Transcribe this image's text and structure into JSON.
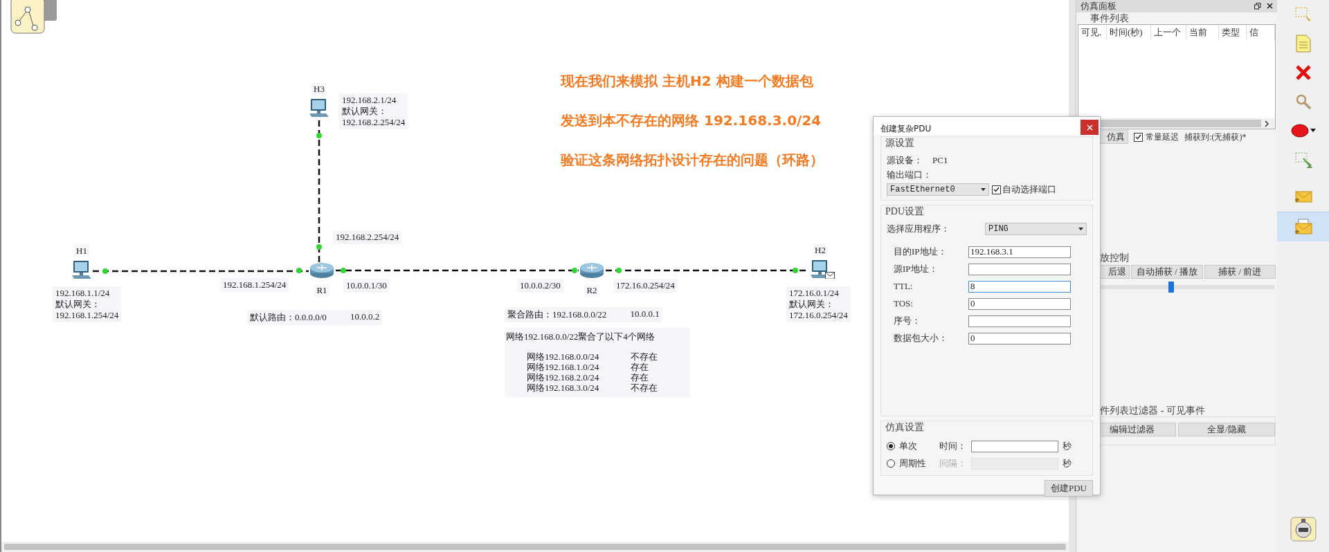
{
  "canvas": {
    "captions": [
      "现在我们来模拟 主机H2 构建一个数据包",
      "发送到本不存在的网络 192.168.3.0/24",
      "验证这条网络拓扑设计存在的问题（环路）"
    ],
    "devices": [
      {
        "kind": "pc",
        "name": "H1",
        "has_pdu": false
      },
      {
        "kind": "router",
        "name": "R1",
        "has_pdu": false
      },
      {
        "kind": "pc",
        "name": "H3",
        "has_pdu": false
      },
      {
        "kind": "router",
        "name": "R2",
        "has_pdu": false
      },
      {
        "kind": "pc",
        "name": "H2",
        "has_pdu": true
      }
    ],
    "notes": [
      {
        "kind": "stack",
        "lines": [
          "192.168.1.1/24",
          "默认网关：",
          "192.168.1.254/24"
        ]
      },
      {
        "kind": "stack",
        "lines": [
          "192.168.2.1/24",
          "默认网关：",
          "192.168.2.254/24"
        ]
      },
      {
        "kind": "stack",
        "lines": [
          "172.16.0.1/24",
          "默认网关：",
          "172.16.0.254/24"
        ]
      },
      {
        "kind": "stack",
        "lines": [
          "192.168.2.254/24"
        ]
      },
      {
        "kind": "stack",
        "lines": [
          "192.168.1.254/24"
        ]
      },
      {
        "kind": "stack",
        "lines": [
          "10.0.0.1/30"
        ]
      },
      {
        "kind": "row",
        "lines": [
          "默认路由：0.0.0.0/0",
          "10.0.0.2"
        ]
      },
      {
        "kind": "stack",
        "lines": [
          "10.0.0.2/30"
        ]
      },
      {
        "kind": "stack",
        "lines": [
          "172.16.0.254/24"
        ]
      },
      {
        "kind": "row",
        "lines": [
          "聚合路由：192.168.0.0/22",
          "10.0.0.1"
        ]
      }
    ],
    "summary": {
      "heading": "网络192.168.0.0/22聚合了以下4个网络",
      "rows": [
        {
          "network": "网络192.168.0.0/24",
          "status": "不存在"
        },
        {
          "network": "网络192.168.1.0/24",
          "status": "存在"
        },
        {
          "network": "网络192.168.2.0/24",
          "status": "存在"
        },
        {
          "network": "网络192.168.3.0/24",
          "status": "不存在"
        }
      ]
    }
  },
  "simulation_panel": {
    "title": "仿真面板",
    "event_list": {
      "title": "事件列表",
      "columns": [
        "可见.",
        "时间(秒)",
        "上一个",
        "当前",
        "类型",
        "信"
      ]
    },
    "options": {
      "button": "仿真",
      "constant_delay": {
        "label": "常量延迟",
        "checked": true
      },
      "captured": "捕获到:(无捕获)*"
    },
    "playback": {
      "title": "放控制",
      "buttons": [
        "后退",
        "自动捕获 / 播放",
        "捕获 / 前进"
      ],
      "speed": {
        "level": 0.47
      }
    },
    "filter": {
      "title": "件列表过滤器 - 可见事件",
      "buttons": [
        "编辑过滤器",
        "全显/隐藏"
      ]
    }
  },
  "toolbar": [
    {
      "kind": "select",
      "selected": false
    },
    {
      "kind": "note",
      "selected": false
    },
    {
      "kind": "delete",
      "selected": false
    },
    {
      "kind": "inspect",
      "selected": false
    },
    {
      "kind": "ellipse",
      "selected": false
    },
    {
      "kind": "resize",
      "selected": false
    },
    {
      "kind": "simple_pdu",
      "selected": false
    },
    {
      "kind": "complex_pdu",
      "selected": true
    }
  ],
  "dialog": {
    "title": "创建复杂PDU",
    "source": {
      "title": "源设置",
      "device_label": "源设备：",
      "device": "PC1",
      "port_label": "输出端口：",
      "port": "FastEthernet0",
      "auto_port": {
        "label": "自动选择端口",
        "checked": true
      }
    },
    "pdu": {
      "title": "PDU设置",
      "app_label": "选择应用程序：",
      "app": "PING",
      "fields": [
        {
          "label": "目的IP地址：",
          "value": "192.168.3.1",
          "focused": false
        },
        {
          "label": "源IP地址：",
          "focused": false
        },
        {
          "label": "TTL:",
          "value": "8",
          "focused": true
        },
        {
          "label": "TOS:",
          "value": "0",
          "focused": false
        },
        {
          "label": "序号：",
          "focused": false
        },
        {
          "label": "数据包大小：",
          "value": "0",
          "focused": false
        }
      ]
    },
    "simulation": {
      "title": "仿真设置",
      "modes": [
        {
          "label": "单次",
          "selected": true,
          "field_label": "时间：",
          "unit": "秒",
          "disabled": false
        },
        {
          "label": "周期性",
          "selected": false,
          "field_label": "间隔：",
          "unit": "秒",
          "disabled": true
        }
      ]
    },
    "button": "创建PDU"
  }
}
